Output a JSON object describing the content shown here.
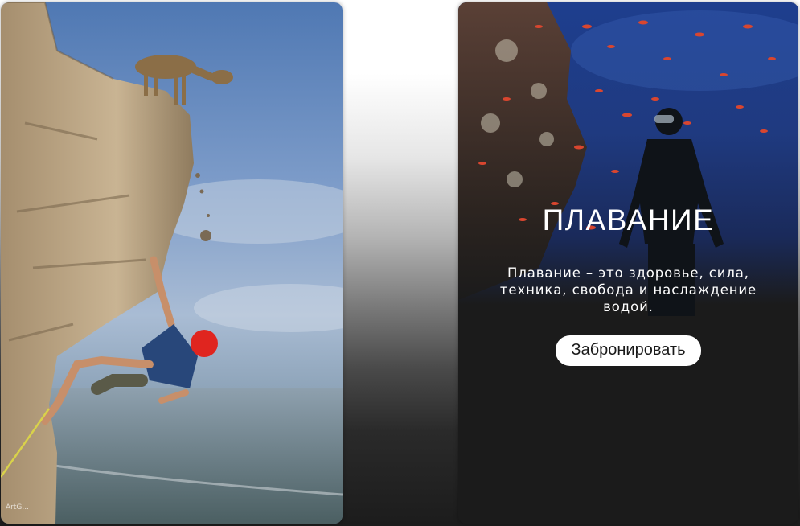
{
  "cards": [
    {
      "id": "climbing",
      "image": "rock-climber-with-goat",
      "watermark": "ArtG..."
    },
    {
      "id": "swimming",
      "image": "freediver-with-fish",
      "title": "ПЛАВАНИЕ",
      "description": "Плавание – это здоровье, сила, техника, свобода и наслаждение водой.",
      "button_label": "Забронировать"
    }
  ],
  "colors": {
    "overlay_text": "#ffffff",
    "button_bg": "#ffffff",
    "button_text": "#1a1a1a",
    "card_dark": "#1b1b1b"
  }
}
